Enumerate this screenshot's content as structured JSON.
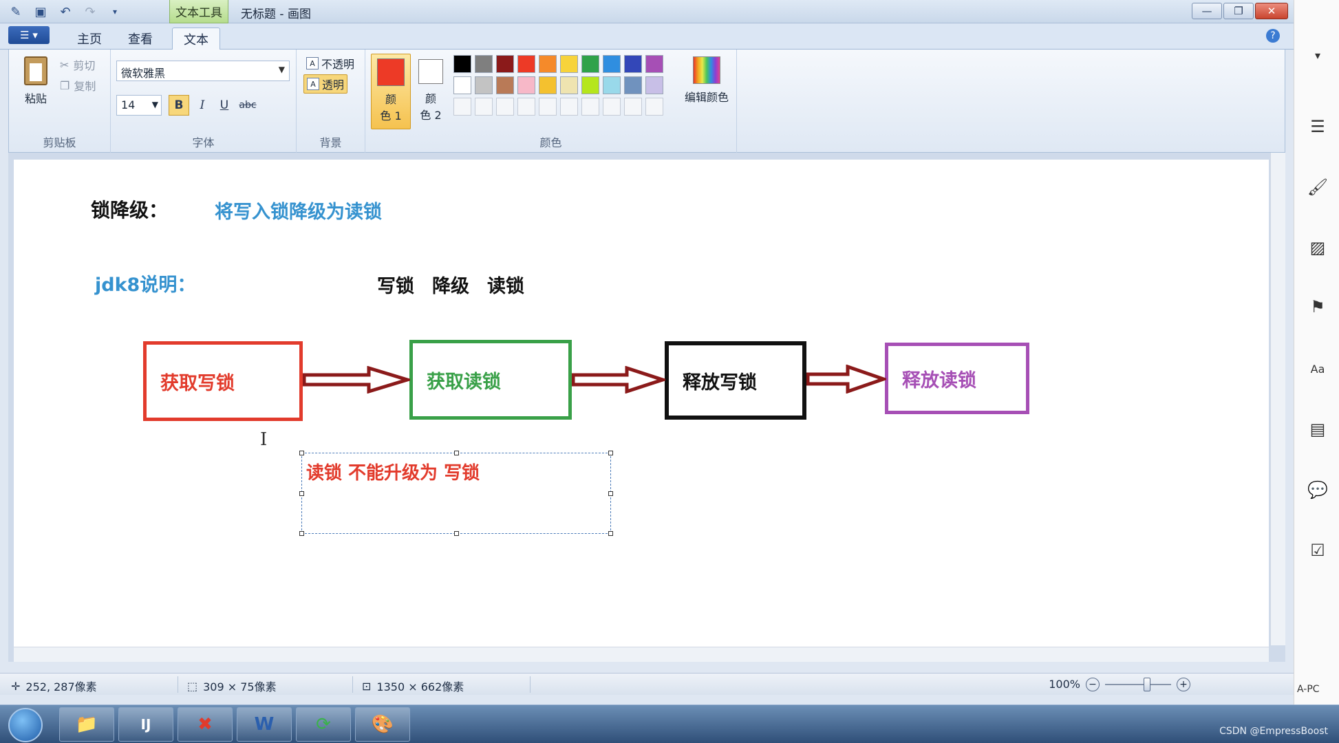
{
  "window": {
    "title": "无标题 - 画图",
    "context_tab": "文本工具"
  },
  "tabs": {
    "home": "主页",
    "view": "查看",
    "text": "文本"
  },
  "clipboard": {
    "paste": "粘贴",
    "cut": "剪切",
    "copy": "复制",
    "group_label": "剪贴板"
  },
  "font": {
    "name": "微软雅黑",
    "size": "14",
    "bold": "B",
    "italic": "I",
    "underline": "U",
    "strike": "abc",
    "group_label": "字体"
  },
  "background": {
    "opaque": "不透明",
    "transparent": "透明",
    "group_label": "背景"
  },
  "colors": {
    "color1_label_a": "颜",
    "color1_label_b": "色 1",
    "color2_label_a": "颜",
    "color2_label_b": "色 2",
    "edit_colors": "编辑颜色",
    "group_label": "颜色",
    "color1": "#ed3a26",
    "color2": "#ffffff",
    "palette_row1": [
      "#000000",
      "#7f7f7f",
      "#8b1a1a",
      "#ed3a26",
      "#f58a2a",
      "#f7d33b",
      "#2fa24a",
      "#2f8ee0",
      "#3347b8",
      "#a64fb5"
    ],
    "palette_row2": [
      "#ffffff",
      "#c3c3c3",
      "#b97a57",
      "#f7b8c8",
      "#f4c12f",
      "#efe4b0",
      "#b5e61d",
      "#99d9ea",
      "#7092be",
      "#c8bfe7"
    ]
  },
  "canvas": {
    "lock_title": "锁降级：",
    "lock_desc": "将写入锁降级为读锁",
    "jdk_label": "jdk8说明：",
    "seq_write": "写锁",
    "seq_downgrade": "降级",
    "seq_read": "读锁",
    "box1": "获取写锁",
    "box2": "获取读锁",
    "box3": "释放写锁",
    "box4": "释放读锁",
    "selection_text": "读锁 不能升级为 写锁"
  },
  "status": {
    "position": "252, 287像素",
    "selection_size": "309 × 75像素",
    "canvas_size": "1350 × 662像素",
    "zoom": "100%"
  },
  "side": {
    "label": "A-PC"
  },
  "tray": {
    "text": "CSDN @EmpressBoost"
  }
}
